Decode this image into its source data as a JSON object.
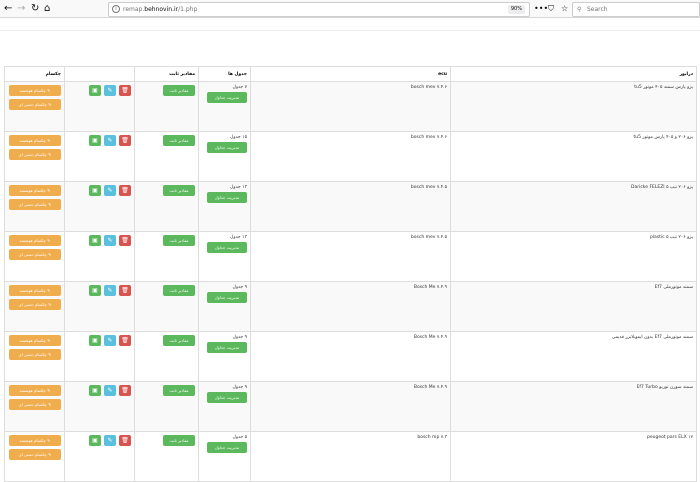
{
  "browser": {
    "url_prefix": "remap.",
    "url_host": "behnovin.ir",
    "url_path": "/1.php",
    "zoom": "90%",
    "search_placeholder": "Search",
    "more_icon": "•••"
  },
  "table": {
    "headers": {
      "driver": "درایور",
      "ecu": "ecu",
      "tables": "جدول ها",
      "fixed_values": "مقادیر ثابت",
      "cell": "چکسام"
    },
    "rows": [
      {
        "driver": "پژو پارس سمند ۴۰۵ موتور tu5",
        "ecu": "bosch mev ۷.۴.۶",
        "tables": "۷ جدول"
      },
      {
        "driver": "پژو ۲۰۶ و ۴۰۵ پارس موتور tu5",
        "ecu": "bosch mev ۷.۴.۶",
        "tables": "۱۵ جدول"
      },
      {
        "driver": "پژو ۲۰۶ تیپ ۵ Daricke FELEZI",
        "ecu": "bosch mev ۷.۴.۵",
        "tables": "۱۳ جدول"
      },
      {
        "driver": "پژو ۲۰۶ تیپ ۵ plastic",
        "ecu": "bosch mev ۷.۴.۵",
        "tables": "۱۳ جدول"
      },
      {
        "driver": "سمند موتورملی Ef7",
        "ecu": "Bosch Me ۷.۴.۹",
        "tables": "۹ جدول"
      },
      {
        "driver": "سمند موتورملی Ef7 بدون ایموبلایزر قدیمی",
        "ecu": "Bosch Me ۷.۴.۹",
        "tables": "۹ جدول"
      },
      {
        "driver": "سمند سورن توربو Ef7 Turbo",
        "ecu": "Bosch Me ۷.۴.۹",
        "tables": "۹ جدول"
      },
      {
        "driver": "peugeot pars ELX ۱۷",
        "ecu": "bosch mp ۷.۳",
        "tables": "۵ جدول"
      }
    ],
    "manage_tables_label": "مدیریت جداول",
    "fixed_values_button": "مقادیر ثابت",
    "checksum_hw_label": "✎ چکسام هوشمند",
    "checksum_manual_label": "✎ چکسام دستی ای"
  }
}
